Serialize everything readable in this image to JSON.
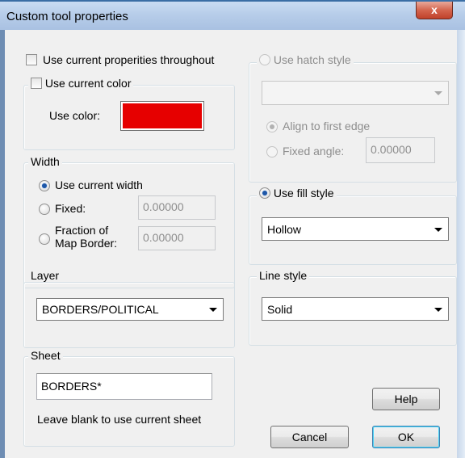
{
  "window": {
    "title": "Custom tool properties",
    "close_label": "x"
  },
  "options": {
    "use_current_properties": {
      "label": "Use current properities throughout",
      "checked": false
    },
    "use_current_color": {
      "label": "Use current color",
      "checked": false
    },
    "use_color_label": "Use color:",
    "color_swatch": "#e60000"
  },
  "width": {
    "legend": "Width",
    "use_current_width": "Use current width",
    "fixed_label": "Fixed:",
    "fixed_value": "0.00000",
    "fraction_label_line1": "Fraction of",
    "fraction_label_line2": "Map Border:",
    "fraction_value": "0.00000",
    "selected": "use_current_width"
  },
  "layer": {
    "legend": "Layer",
    "selected": "BORDERS/POLITICAL"
  },
  "sheet": {
    "legend": "Sheet",
    "value": "BORDERS*",
    "hint": "Leave blank to use current sheet"
  },
  "hatch": {
    "legend": "Use hatch style",
    "enabled": false,
    "selected": "",
    "align_label": "Align to first edge",
    "fixed_angle_label": "Fixed angle:",
    "fixed_angle_value": "0.00000"
  },
  "fill": {
    "legend": "Use fill style",
    "selected": "Hollow"
  },
  "line_style": {
    "legend": "Line style",
    "selected": "Solid"
  },
  "buttons": {
    "help": "Help",
    "cancel": "Cancel",
    "ok": "OK"
  },
  "colors": {
    "title_bar": "#b7cde9",
    "close_button": "#d4654e",
    "dialog_bg": "#f0f0f0",
    "color_swatch": "#e60000"
  }
}
